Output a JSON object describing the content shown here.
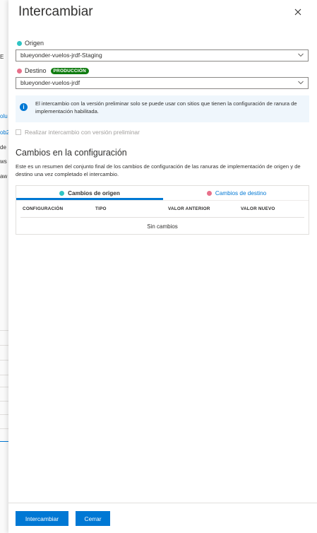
{
  "background": {
    "fragments": [
      "E",
      "olu",
      "ob2",
      "de",
      "ws",
      "aw"
    ]
  },
  "header": {
    "title": "Intercambiar"
  },
  "source": {
    "label": "Origen",
    "value": "blueyonder-vuelos-jrdf-Staging",
    "dot_color": "#2fc4c4"
  },
  "target": {
    "label": "Destino",
    "badge": "PRODUCCIÓN",
    "value": "blueyonder-vuelos-jrdf",
    "dot_color": "#e8708a"
  },
  "info": {
    "text": "El intercambio con la versión preliminar solo se puede usar con sitios que tienen la configuración de ranura de implementación habilitada."
  },
  "preview_checkbox": {
    "label": "Realizar intercambio con versión preliminar",
    "checked": false
  },
  "config_changes": {
    "title": "Cambios en la configuración",
    "description": "Este es un resumen del conjunto final de los cambios de configuración de las ranuras de implementación de origen y de destino una vez completado el intercambio.",
    "tabs": [
      {
        "label": "Cambios de origen",
        "active": true
      },
      {
        "label": "Cambios de destino",
        "active": false
      }
    ],
    "columns": [
      "CONFIGURACIÓN",
      "TIPO",
      "VALOR ANTERIOR",
      "VALOR NUEVO"
    ],
    "empty_text": "Sin cambios"
  },
  "footer": {
    "swap_label": "Intercambiar",
    "close_label": "Cerrar"
  },
  "colors": {
    "accent": "#0078d4",
    "badge": "#107c10"
  }
}
